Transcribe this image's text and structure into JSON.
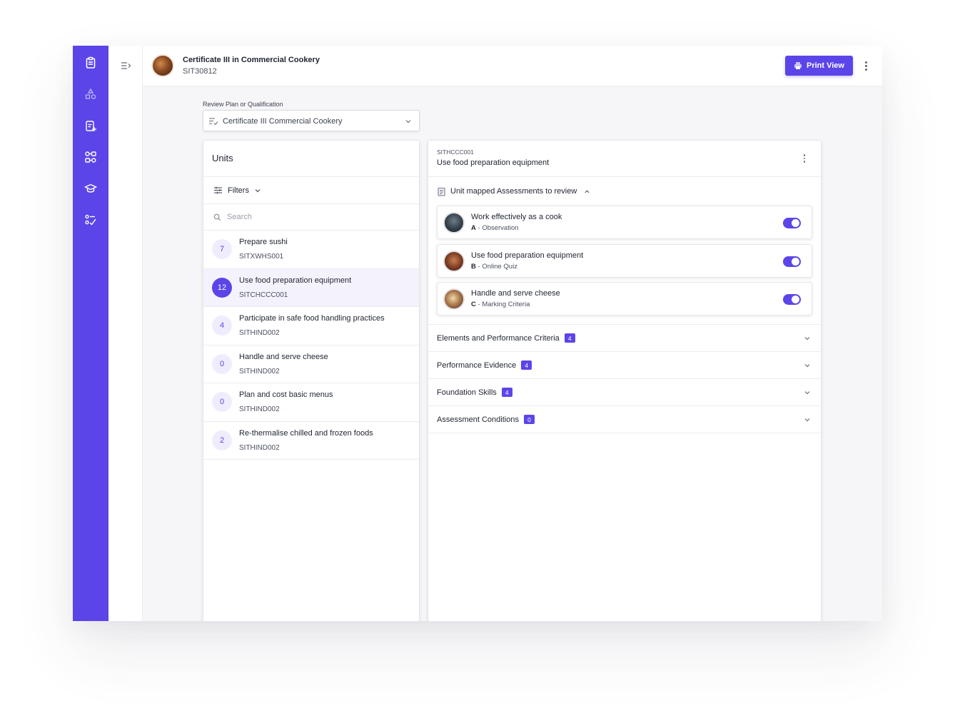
{
  "header": {
    "title": "Certificate III in Commercial Cookery",
    "code": "SIT30812",
    "print_label": "Print View"
  },
  "nav_rail": {
    "icons": [
      "clipboard-icon",
      "shapes-icon",
      "clipboard-add-icon",
      "workflow-icon",
      "graduation-cap-icon",
      "checklist-icon"
    ]
  },
  "review_select": {
    "label": "Review Plan or Qualification",
    "value": "Certificate III Commercial Cookery"
  },
  "units": {
    "title": "Units",
    "filters_label": "Filters",
    "search_placeholder": "Search",
    "items": [
      {
        "count": "7",
        "name": "Prepare sushi",
        "code": "SITXWHS001",
        "selected": false
      },
      {
        "count": "12",
        "name": "Use food preparation equipment",
        "code": "SITCHCCC001",
        "selected": true
      },
      {
        "count": "4",
        "name": "Participate in safe food handling practices",
        "code": "SITHIND002",
        "selected": false
      },
      {
        "count": "0",
        "name": "Handle and serve cheese",
        "code": "SITHIND002",
        "selected": false
      },
      {
        "count": "0",
        "name": "Plan and cost basic menus",
        "code": "SITHIND002",
        "selected": false
      },
      {
        "count": "2",
        "name": "Re-thermalise chilled and frozen foods",
        "code": "SITHIND002",
        "selected": false
      }
    ]
  },
  "detail": {
    "code": "SITHCCC001",
    "title": "Use food preparation equipment",
    "mapped_heading": "Unit mapped Assessments to review",
    "assessments": [
      {
        "name": "Work effectively as a cook",
        "letter": "A",
        "type": " - Observation",
        "enabled": true
      },
      {
        "name": "Use food preparation equipment",
        "letter": "B",
        "type": " - Online Quiz",
        "enabled": true
      },
      {
        "name": "Handle and serve cheese",
        "letter": "C",
        "type": " - Marking Criteria",
        "enabled": true
      }
    ],
    "sections": [
      {
        "label": "Elements and Performance Criteria",
        "count": "4"
      },
      {
        "label": "Performance Evidence",
        "count": "4"
      },
      {
        "label": "Foundation Skills",
        "count": "4"
      },
      {
        "label": "Assessment Conditions",
        "count": "0"
      }
    ]
  },
  "colors": {
    "accent": "#5b45e8",
    "selected_row": "#f4f3fd"
  }
}
